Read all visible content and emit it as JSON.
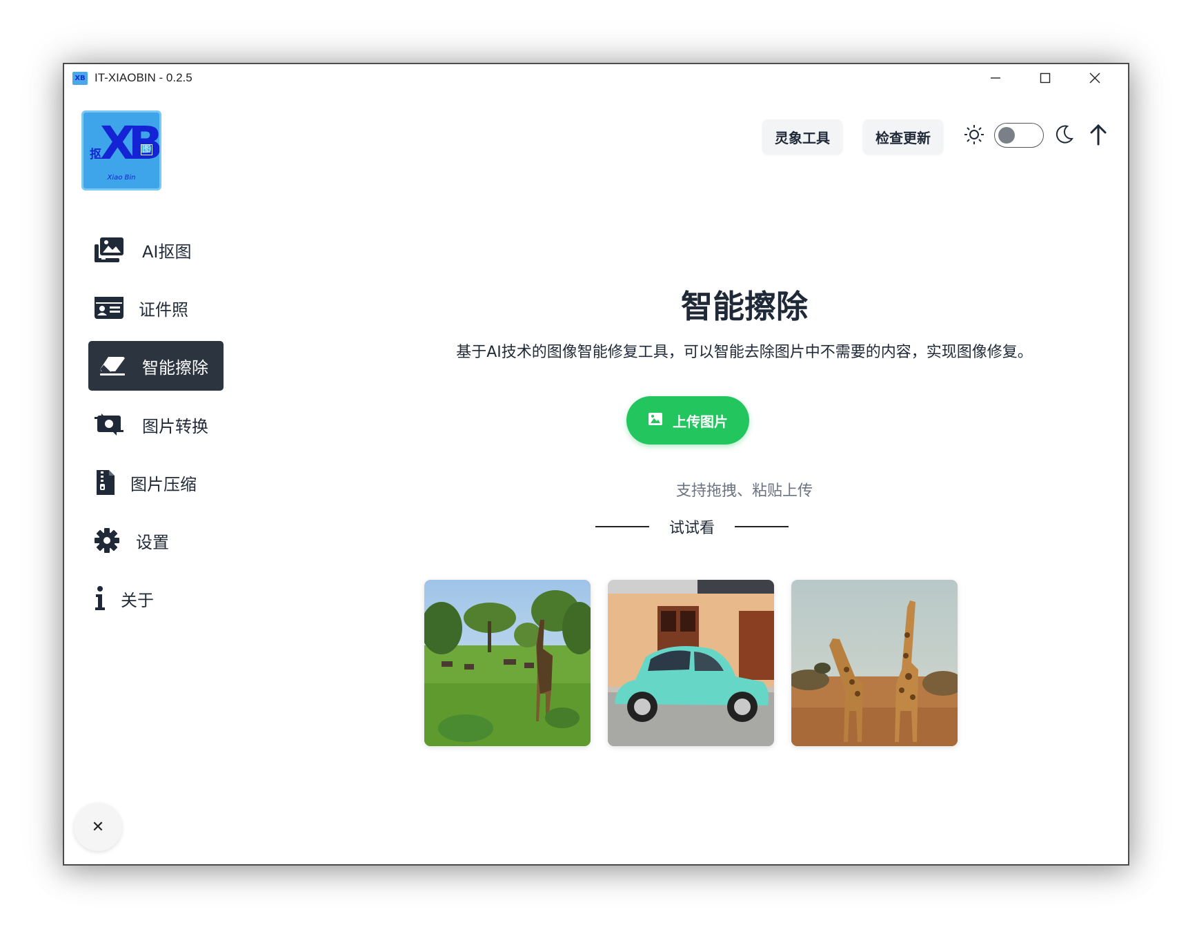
{
  "window": {
    "title": "IT-XIAOBIN - 0.2.5"
  },
  "logo": {
    "main": "XB",
    "left_char": "抠",
    "right_char": "图",
    "subtitle": "Xiao Bin"
  },
  "sidebar": {
    "items": [
      {
        "label": "AI抠图",
        "icon": "images-icon",
        "active": false
      },
      {
        "label": "证件照",
        "icon": "id-card-icon",
        "active": false
      },
      {
        "label": "智能擦除",
        "icon": "eraser-icon",
        "active": true
      },
      {
        "label": "图片转换",
        "icon": "money-bill-transfer-icon",
        "active": false
      },
      {
        "label": "图片压缩",
        "icon": "file-zipper-icon",
        "active": false
      },
      {
        "label": "设置",
        "icon": "gear-icon",
        "active": false
      },
      {
        "label": "关于",
        "icon": "info-icon",
        "active": false
      }
    ]
  },
  "header": {
    "buttons": [
      "灵象工具",
      "检查更新"
    ],
    "theme_toggle": {
      "state": "off"
    }
  },
  "main": {
    "title": "智能擦除",
    "description": "基于AI技术的图像智能修复工具，可以智能去除图片中不需要的内容，实现图像修复。",
    "upload_label": "上传图片",
    "hint": "支持拖拽、粘贴上传",
    "try_label": "试试看",
    "samples": [
      "giraffe-savanna",
      "turquoise-beetle-car",
      "two-giraffes"
    ]
  },
  "colors": {
    "accent_green": "#22c55e",
    "active_nav_bg": "#2c3440",
    "text_dark": "#1f2937",
    "hint_gray": "#6b7280"
  }
}
